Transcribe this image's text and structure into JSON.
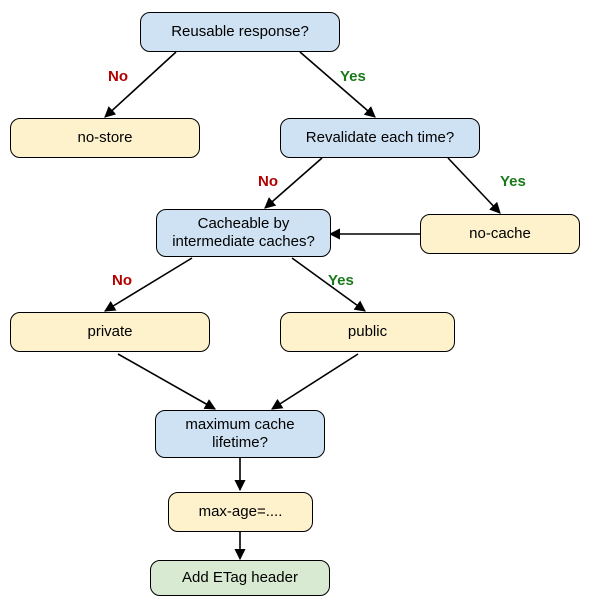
{
  "labels": {
    "no": "No",
    "yes": "Yes"
  },
  "nodes": {
    "reusable": "Reusable response?",
    "no_store": "no-store",
    "revalidate": "Revalidate each time?",
    "intermediate": "Cacheable by intermediate caches?",
    "no_cache": "no-cache",
    "private": "private",
    "public": "public",
    "lifetime": "maximum cache lifetime?",
    "max_age": "max-age=....",
    "etag": "Add ETag header"
  }
}
